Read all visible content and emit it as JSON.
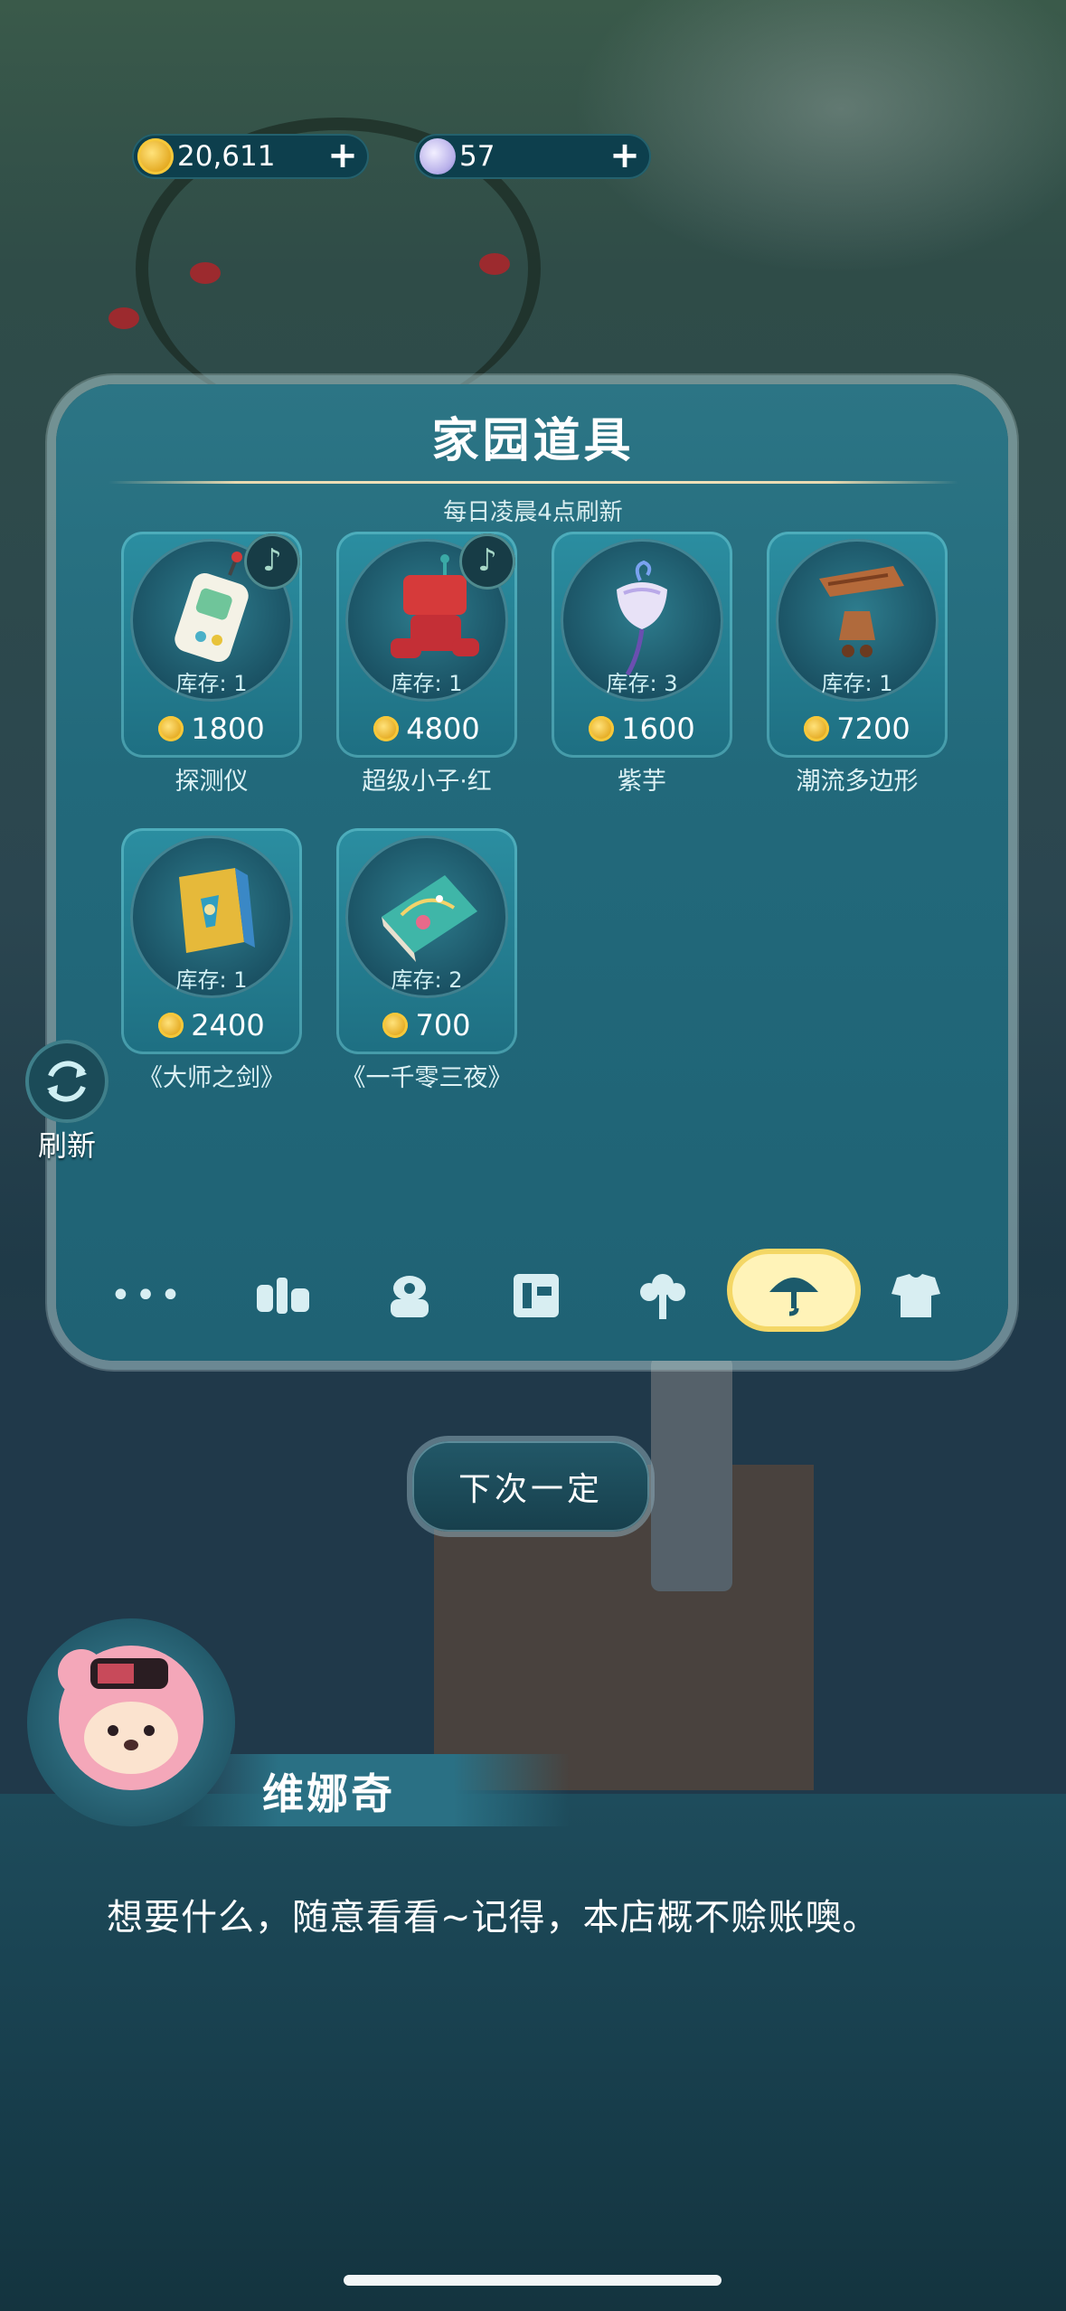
{
  "currencies": {
    "coins": {
      "value": "20,611",
      "icon": "gold-coin-icon"
    },
    "moons": {
      "value": "57",
      "icon": "moon-gem-icon"
    }
  },
  "shop": {
    "title": "家园道具",
    "subtitle": "每日凌晨4点刷新",
    "items": [
      {
        "name": "探测仪",
        "stock": "库存: 1",
        "price": "1800",
        "music_badge": "♪"
      },
      {
        "name": "超级小子·红",
        "stock": "库存: 1",
        "price": "4800",
        "music_badge": "♪"
      },
      {
        "name": "紫芋",
        "stock": "库存: 3",
        "price": "1600"
      },
      {
        "name": "潮流多边形",
        "stock": "库存: 1",
        "price": "7200"
      },
      {
        "name": "《大师之剑》",
        "stock": "库存: 1",
        "price": "2400"
      },
      {
        "name": "《一千零三夜》",
        "stock": "库存: 2",
        "price": "700"
      }
    ],
    "tabs": [
      {
        "icon": "more-dots-icon",
        "label": "•••"
      },
      {
        "icon": "food-icon"
      },
      {
        "icon": "plant-icon"
      },
      {
        "icon": "music-score-icon"
      },
      {
        "icon": "flower-icon"
      },
      {
        "icon": "umbrella-icon",
        "active": true
      },
      {
        "icon": "clothes-icon"
      }
    ]
  },
  "refresh": {
    "label": "刷新"
  },
  "next_button": {
    "label": "下次一定"
  },
  "dialog": {
    "speaker": "维娜奇",
    "text": "想要什么，随意看看~记得，本店概不赊账噢。"
  },
  "colors": {
    "panel": "#22697b",
    "accent_active_tab": "#fff3b8",
    "coin": "#e2a51a"
  }
}
